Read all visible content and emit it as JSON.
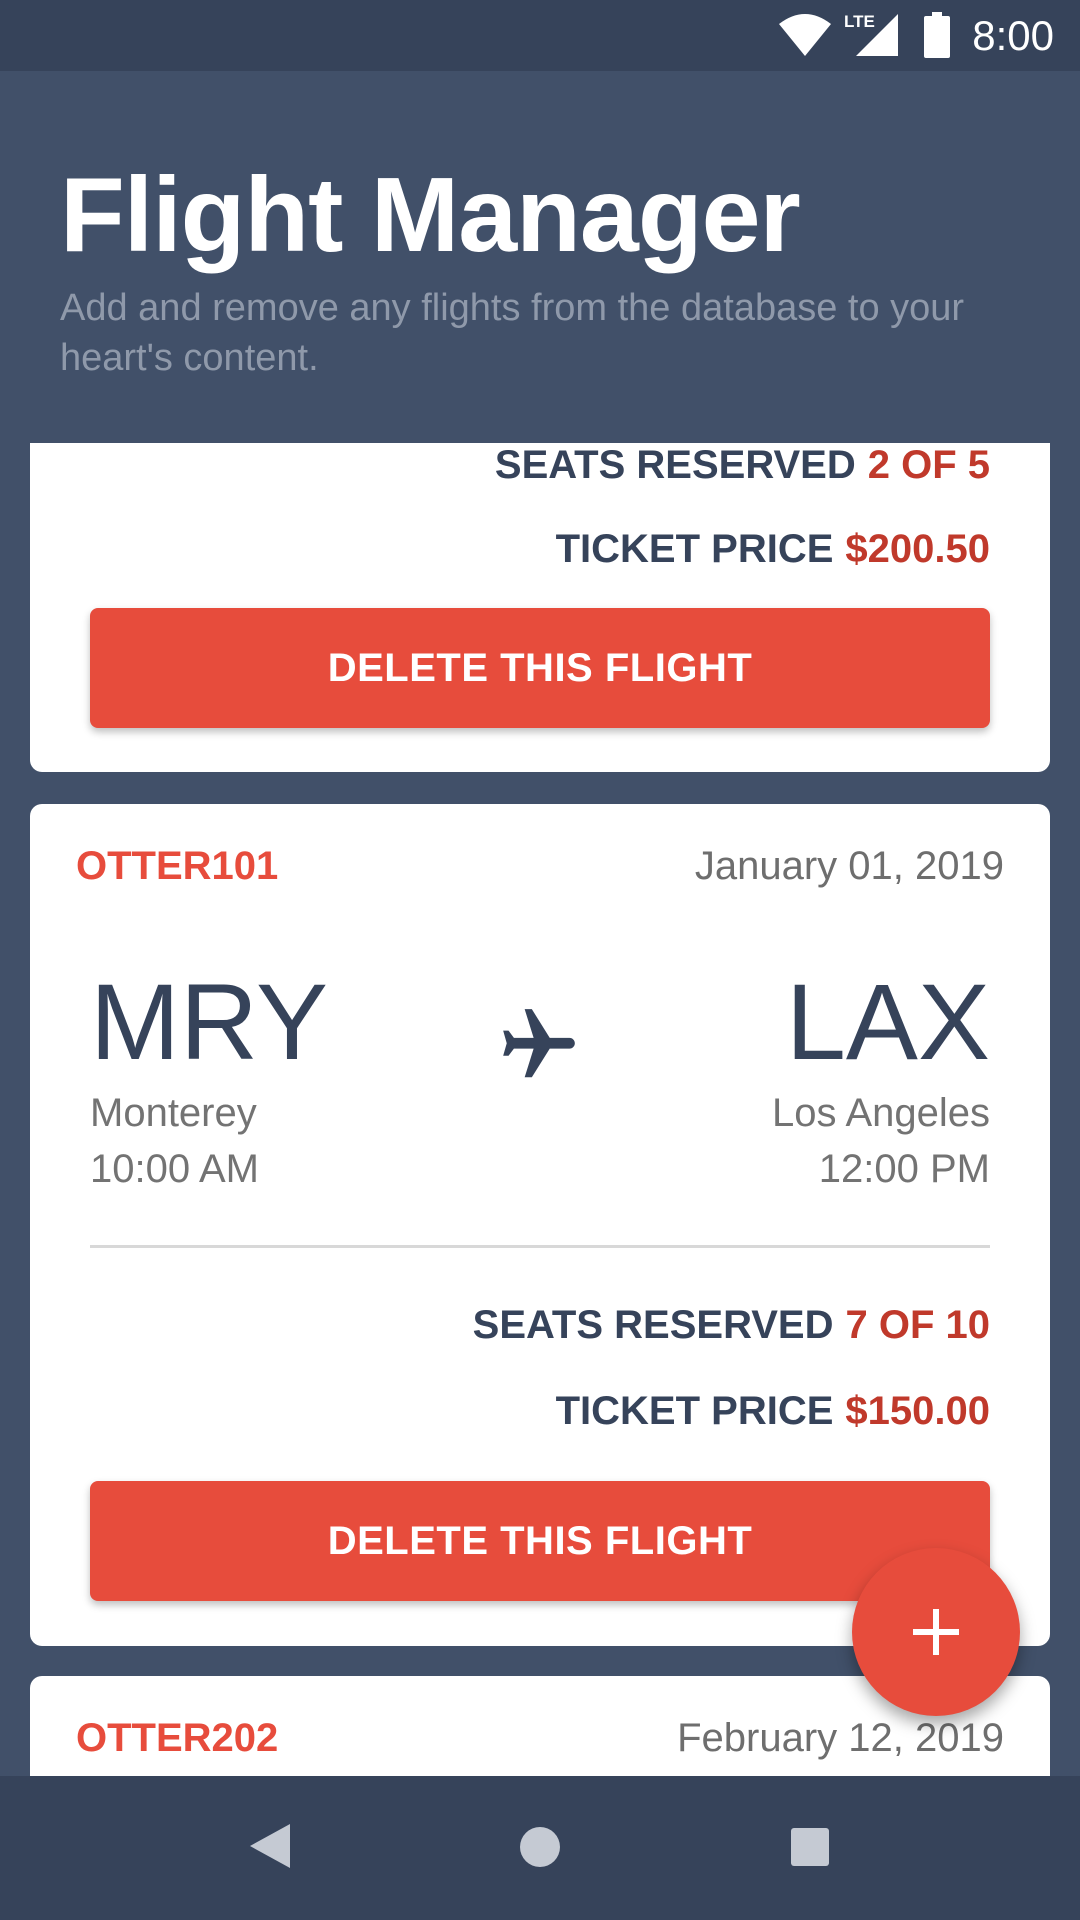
{
  "status_bar": {
    "time": "8:00",
    "network": "LTE",
    "icons": [
      "wifi-icon",
      "signal-icon",
      "battery-icon"
    ]
  },
  "header": {
    "title": "Flight Manager",
    "subtitle": "Add and remove any flights from the database to your heart's content."
  },
  "labels": {
    "seats_reserved": "SEATS RESERVED",
    "ticket_price": "TICKET PRICE",
    "delete_button": "DELETE THIS FLIGHT"
  },
  "flights": [
    {
      "seats": "2 OF 5",
      "price": "$200.50"
    },
    {
      "id": "OTTER101",
      "date": "January 01, 2019",
      "from_code": "MRY",
      "from_city": "Monterey",
      "from_time": "10:00 AM",
      "to_code": "LAX",
      "to_city": "Los Angeles",
      "to_time": "12:00 PM",
      "seats": "7 OF 10",
      "price": "$150.00"
    },
    {
      "id": "OTTER202",
      "date": "February 12, 2019"
    }
  ],
  "fab": {
    "icon": "plus-icon"
  },
  "nav_bar": {
    "icons": [
      "back-icon",
      "home-icon",
      "recents-icon"
    ]
  },
  "colors": {
    "background": "#415069",
    "status_bar": "#36435a",
    "accent": "#e74c3c",
    "value_red": "#c0392b",
    "text_dark": "#36435a",
    "text_gray": "#737373",
    "card": "#ffffff"
  }
}
